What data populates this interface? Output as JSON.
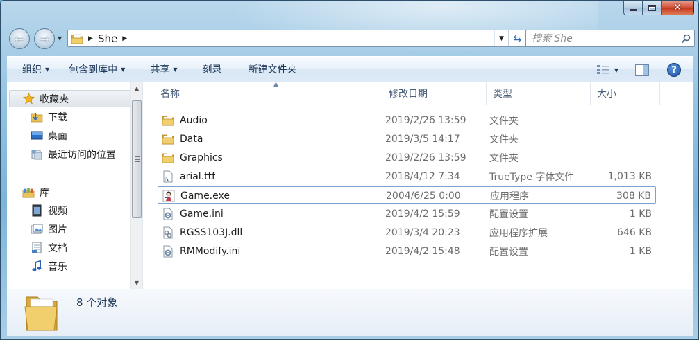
{
  "window": {
    "caption_buttons": {
      "minimize": "minimize",
      "maximize": "maximize",
      "close": "close"
    }
  },
  "nav": {
    "breadcrumb": [
      "She"
    ],
    "search_placeholder": "搜索 She"
  },
  "toolbar": {
    "organize": "组织",
    "include_in_library": "包含到库中",
    "share": "共享",
    "burn": "刻录",
    "new_folder": "新建文件夹"
  },
  "sidebar": {
    "favorites": {
      "label": "收藏夹",
      "items": [
        {
          "label": "下载",
          "icon": "download-folder-icon"
        },
        {
          "label": "桌面",
          "icon": "desktop-icon"
        },
        {
          "label": "最近访问的位置",
          "icon": "recent-places-icon"
        }
      ]
    },
    "libraries": {
      "label": "库",
      "items": [
        {
          "label": "视频",
          "icon": "videos-icon"
        },
        {
          "label": "图片",
          "icon": "pictures-icon"
        },
        {
          "label": "文档",
          "icon": "documents-icon"
        },
        {
          "label": "音乐",
          "icon": "music-icon"
        }
      ]
    }
  },
  "columns": {
    "name": "名称",
    "date": "修改日期",
    "type": "类型",
    "size": "大小"
  },
  "files": [
    {
      "name": "Audio",
      "date": "2019/2/26 13:59",
      "type": "文件夹",
      "size": "",
      "icon": "folder-icon"
    },
    {
      "name": "Data",
      "date": "2019/3/5 14:17",
      "type": "文件夹",
      "size": "",
      "icon": "folder-icon"
    },
    {
      "name": "Graphics",
      "date": "2019/2/26 13:59",
      "type": "文件夹",
      "size": "",
      "icon": "folder-icon"
    },
    {
      "name": "arial.ttf",
      "date": "2018/4/12 7:34",
      "type": "TrueType 字体文件",
      "size": "1,013 KB",
      "icon": "font-file-icon"
    },
    {
      "name": "Game.exe",
      "date": "2004/6/25 0:00",
      "type": "应用程序",
      "size": "308 KB",
      "icon": "game-exe-icon",
      "selected": true
    },
    {
      "name": "Game.ini",
      "date": "2019/4/2 15:59",
      "type": "配置设置",
      "size": "1 KB",
      "icon": "settings-file-icon"
    },
    {
      "name": "RGSS103J.dll",
      "date": "2019/3/4 20:23",
      "type": "应用程序扩展",
      "size": "646 KB",
      "icon": "dll-file-icon"
    },
    {
      "name": "RMModify.ini",
      "date": "2019/4/2 15:48",
      "type": "配置设置",
      "size": "1 KB",
      "icon": "settings-file-icon"
    }
  ],
  "details": {
    "count_text": "8 个对象"
  },
  "colors": {
    "folder": "#e9c25a",
    "toolbar_text": "#1e395b",
    "selection_border": "#7da2ce"
  }
}
